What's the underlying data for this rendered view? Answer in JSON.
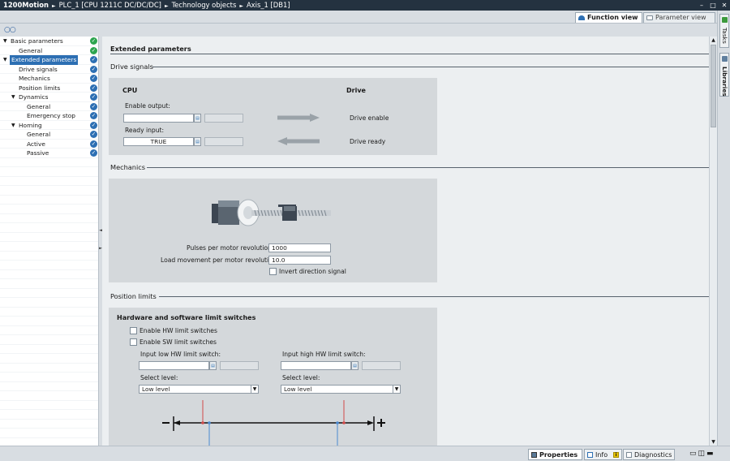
{
  "breadcrumb": [
    "1200Motion",
    "PLC_1 [CPU 1211C DC/DC/DC]",
    "Technology objects",
    "Axis_1 [DB1]"
  ],
  "window_controls": [
    "–",
    "□",
    "✕"
  ],
  "view_tabs": {
    "function_view": "Function view",
    "parameter_view": "Parameter view"
  },
  "right_tabs": {
    "tasks": "Tasks",
    "libraries": "Libraries"
  },
  "nav": {
    "items": [
      {
        "label": "Basic parameters",
        "status": "green",
        "expander": "▼"
      },
      {
        "label": "General",
        "status": "green",
        "expander": ""
      },
      {
        "label": "Extended parameters",
        "status": "blue",
        "expander": "▼"
      },
      {
        "label": "Drive signals",
        "status": "blue",
        "expander": ""
      },
      {
        "label": "Mechanics",
        "status": "blue",
        "expander": ""
      },
      {
        "label": "Position limits",
        "status": "blue",
        "expander": ""
      },
      {
        "label": "Dynamics",
        "status": "blue",
        "expander": "▼"
      },
      {
        "label": "General",
        "status": "blue",
        "expander": ""
      },
      {
        "label": "Emergency stop",
        "status": "blue",
        "expander": ""
      },
      {
        "label": "Homing",
        "status": "blue",
        "expander": "▼"
      },
      {
        "label": "General",
        "status": "blue",
        "expander": ""
      },
      {
        "label": "Active",
        "status": "blue",
        "expander": ""
      },
      {
        "label": "Passive",
        "status": "blue",
        "expander": ""
      }
    ]
  },
  "content": {
    "title": "Extended parameters",
    "drive_signals": {
      "section": "Drive signals",
      "cpu_label": "CPU",
      "drive_label": "Drive",
      "enable_output_label": "Enable output:",
      "enable_output_value": "",
      "ready_input_label": "Ready input:",
      "ready_input_value": "TRUE",
      "drive_enable": "Drive enable",
      "drive_ready": "Drive ready"
    },
    "mechanics": {
      "section": "Mechanics",
      "pulses_label": "Pulses per motor revolution:",
      "pulses_value": "1000",
      "load_label": "Load movement per motor revolution:",
      "load_value": "10.0",
      "invert_label": "Invert direction signal"
    },
    "position_limits": {
      "section": "Position limits",
      "hw_sw_title": "Hardware and software limit switches",
      "enable_hw": "Enable HW limit switches",
      "enable_sw": "Enable SW limit switches",
      "input_low_label": "Input low HW limit switch:",
      "input_high_label": "Input high HW limit switch:",
      "select_level_low_label": "Select level:",
      "select_level_high_label": "Select level:",
      "low_level_value": "Low level",
      "high_level_value": "Low level"
    }
  },
  "status_tabs": {
    "properties": "Properties",
    "info": "Info",
    "diagnostics": "Diagnostics"
  },
  "colors": {
    "titlebar": "#243240",
    "accent": "#2d6fb3",
    "ok_green": "#2da44e",
    "panel": "#d4d8db"
  }
}
